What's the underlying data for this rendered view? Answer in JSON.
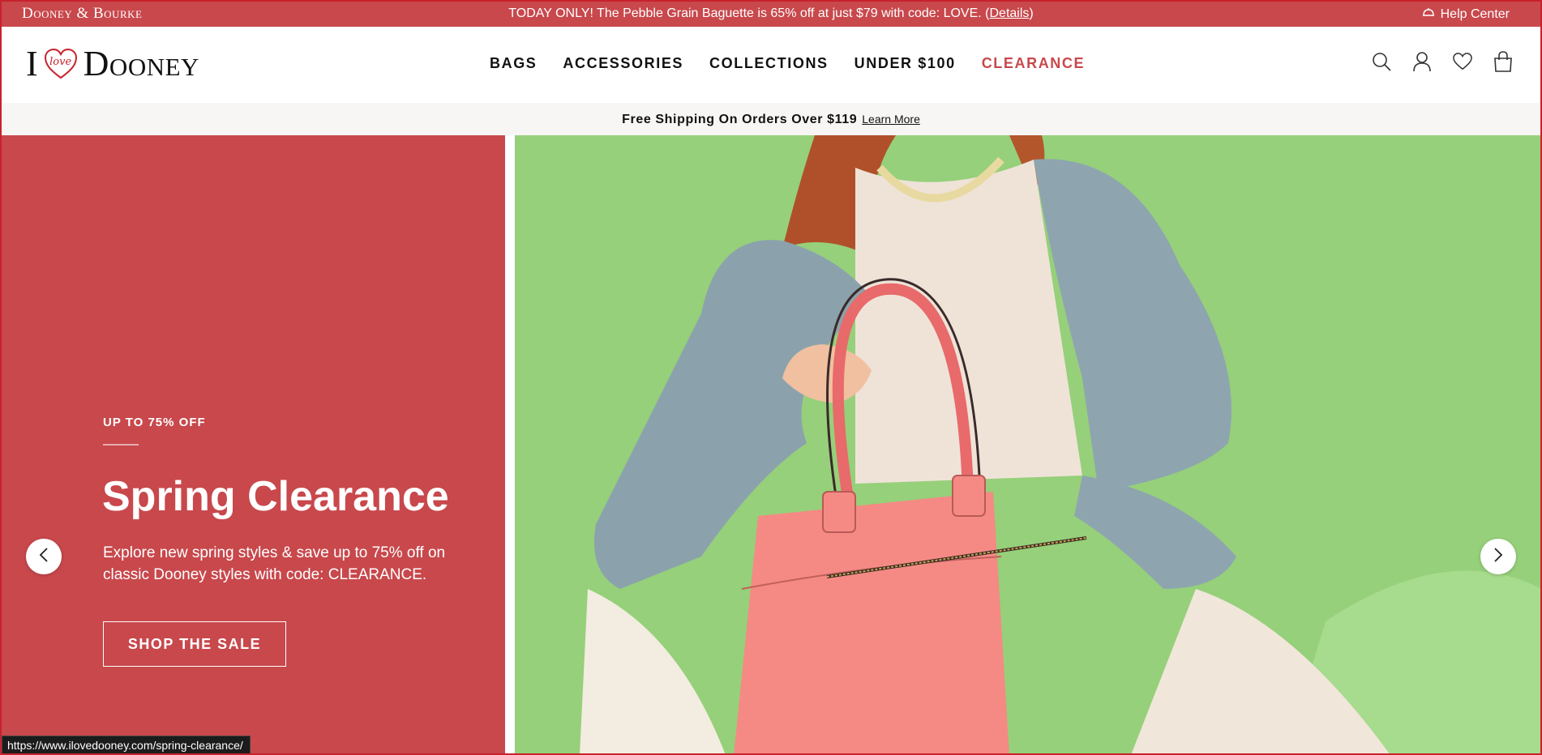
{
  "promo_bar": {
    "brand": "Dooney & Bourke",
    "message": "TODAY ONLY! The Pebble Grain Baguette is 65% off at just $79 with code: LOVE. (",
    "details_link": "Details",
    "message_end": ")",
    "help_center": "Help Center",
    "bg_color": "#c8484c"
  },
  "header": {
    "logo": {
      "i": "I",
      "love": "love",
      "word": "Dooney"
    },
    "nav": [
      "BAGS",
      "ACCESSORIES",
      "COLLECTIONS",
      "UNDER $100",
      "CLEARANCE"
    ],
    "icons": [
      "search-icon",
      "account-icon",
      "wishlist-heart-icon",
      "shopping-bag-icon"
    ]
  },
  "shipping_bar": {
    "text": "Free Shipping On Orders Over $119",
    "link": "Learn More"
  },
  "hero": {
    "kicker": "UP TO 75% OFF",
    "title": "Spring Clearance",
    "description": "Explore new spring styles & save up to 75% off on classic Dooney styles with code: CLEARANCE.",
    "cta": "SHOP THE SALE",
    "image_alt": "Woman in blue knit sweater holding a coral pink leather tote bag on a green background",
    "accent_color": "#c8484c",
    "image_bg_color": "#96d07a"
  },
  "carousel": {
    "prev_icon": "chevron-left-icon",
    "next_icon": "chevron-right-icon"
  },
  "status_bar": {
    "url": "https://www.ilovedooney.com/spring-clearance/"
  }
}
